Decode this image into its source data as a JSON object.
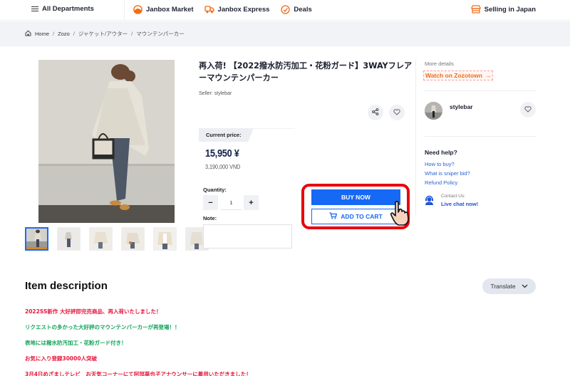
{
  "colors": {
    "primary": "#1569f5",
    "orange": "#ef6c14",
    "highlight": "#e8000c",
    "desc_red": "#e8163c",
    "desc_green": "#12a55a"
  },
  "topnav": {
    "departments_label": "All Departments",
    "links": [
      {
        "label": "Janbox Market",
        "icon": "market-dome-icon"
      },
      {
        "label": "Janbox Express",
        "icon": "delivery-truck-icon"
      },
      {
        "label": "Deals",
        "icon": "deals-tag-icon"
      }
    ],
    "selling_label": "Selling in Japan"
  },
  "breadcrumb": [
    "Home",
    "Zozo",
    "ジャケット/アウター",
    "マウンテンパーカー"
  ],
  "product": {
    "title": "再入荷! 【2022撥水防汚加工・花粉ガード】3WAYフレアーマウンテンパーカー",
    "seller_label": "Seller: stylebar",
    "current_price_label": "Current price:",
    "price": "15,950 ¥",
    "price_vnd": "3,190,000 VND",
    "quantity_label": "Quantity:",
    "quantity": "1",
    "minus": "−",
    "plus": "+",
    "note_label": "Note:",
    "note_value": "",
    "buy_now": "BUY NOW",
    "add_to_cart": "ADD TO CART",
    "thumbnail_count": 6,
    "selected_thumbnail": 1
  },
  "sidebar": {
    "more_details": "More details",
    "watch_link": "Watch on Zozotown",
    "seller_name": "stylebar",
    "need_help": "Need help?",
    "help_links": [
      "How to buy?",
      "What is sniper bid?",
      "Refund Policy"
    ],
    "contact_label": "Contact Us:",
    "live_chat": "Live chat now!"
  },
  "description": {
    "title": "Item description",
    "translate": "Translate",
    "lines": [
      {
        "text": "2022SS新作 大好評即完売商品、再入荷いたしました！",
        "color": "red"
      },
      {
        "text": "リクエストの多かった大好評のマウンテンパーカーが再登場！！",
        "color": "green"
      },
      {
        "text": "表地には撥水防汚加工・花粉ガード付き！",
        "color": "green"
      },
      {
        "text": "お気に入り登録30000人突破",
        "color": "red"
      },
      {
        "text": "3月4日めざましテレビ　お天気コーナーにて阿部華也子アナウンサーに着用いただきました！",
        "color": "red"
      }
    ]
  }
}
